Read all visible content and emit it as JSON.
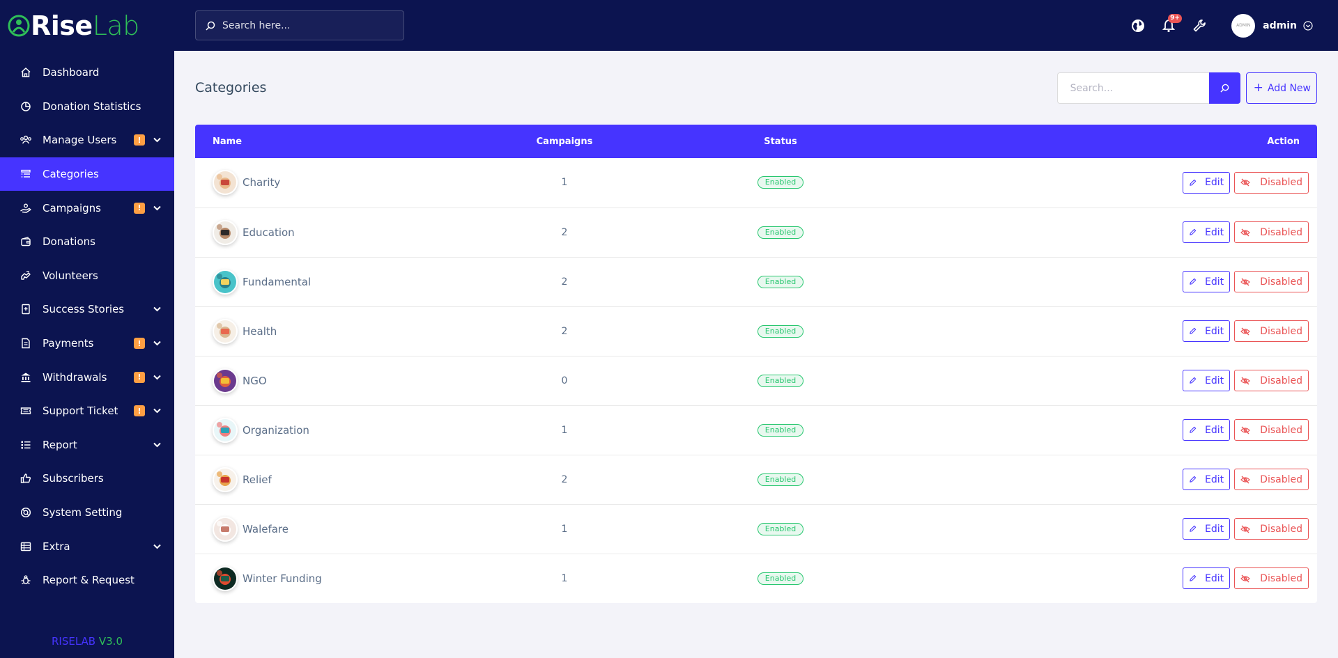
{
  "brand": {
    "name_part1": "Rise",
    "name_part2": "Lab"
  },
  "sidebar": {
    "items": [
      {
        "label": "Dashboard",
        "icon": "home-icon",
        "active": false,
        "warn": false,
        "chevron": false
      },
      {
        "label": "Donation Statistics",
        "icon": "pie-chart-icon",
        "active": false,
        "warn": false,
        "chevron": false
      },
      {
        "label": "Manage Users",
        "icon": "users-icon",
        "active": false,
        "warn": true,
        "chevron": true
      },
      {
        "label": "Categories",
        "icon": "list-icon",
        "active": true,
        "warn": false,
        "chevron": false
      },
      {
        "label": "Campaigns",
        "icon": "hand-holding-icon",
        "active": false,
        "warn": true,
        "chevron": true
      },
      {
        "label": "Donations",
        "icon": "wallet-icon",
        "active": false,
        "warn": false,
        "chevron": false
      },
      {
        "label": "Volunteers",
        "icon": "hands-helping-icon",
        "active": false,
        "warn": false,
        "chevron": false
      },
      {
        "label": "Success Stories",
        "icon": "book-icon",
        "active": false,
        "warn": false,
        "chevron": true
      },
      {
        "label": "Payments",
        "icon": "invoice-icon",
        "active": false,
        "warn": true,
        "chevron": true
      },
      {
        "label": "Withdrawals",
        "icon": "bank-icon",
        "active": false,
        "warn": true,
        "chevron": true
      },
      {
        "label": "Support Ticket",
        "icon": "ticket-icon",
        "active": false,
        "warn": true,
        "chevron": true
      },
      {
        "label": "Report",
        "icon": "list-ul-icon",
        "active": false,
        "warn": false,
        "chevron": true
      },
      {
        "label": "Subscribers",
        "icon": "thumbs-up-icon",
        "active": false,
        "warn": false,
        "chevron": false
      },
      {
        "label": "System Setting",
        "icon": "life-ring-icon",
        "active": false,
        "warn": false,
        "chevron": false
      },
      {
        "label": "Extra",
        "icon": "server-icon",
        "active": false,
        "warn": false,
        "chevron": true
      },
      {
        "label": "Report & Request",
        "icon": "bug-icon",
        "active": false,
        "warn": false,
        "chevron": false
      }
    ],
    "warn_symbol": "!",
    "version_name": "RISELAB",
    "version_number": "V3.0"
  },
  "topbar": {
    "search_placeholder": "Search here...",
    "notification_badge": "9+",
    "user_name": "admin",
    "avatar_text": "ADMIN"
  },
  "main": {
    "page_title": "Categories",
    "search_placeholder": "Search...",
    "add_button_label": "Add New",
    "table": {
      "headers": {
        "name": "Name",
        "campaigns": "Campaigns",
        "status": "Status",
        "action": "Action"
      },
      "rows": [
        {
          "name": "Charity",
          "campaigns": "1",
          "status": "Enabled",
          "thumb_colors": [
            "#f3e3d3",
            "#c9483b",
            "#e9b98a"
          ]
        },
        {
          "name": "Education",
          "campaigns": "2",
          "status": "Enabled",
          "thumb_colors": [
            "#f0ece6",
            "#2d2a2a",
            "#b88a6a"
          ]
        },
        {
          "name": "Fundamental",
          "campaigns": "2",
          "status": "Enabled",
          "thumb_colors": [
            "#49c3c9",
            "#f4d35e",
            "#2a7f8a"
          ]
        },
        {
          "name": "Health",
          "campaigns": "2",
          "status": "Enabled",
          "thumb_colors": [
            "#f6efe6",
            "#e9684f",
            "#d9b892"
          ]
        },
        {
          "name": "NGO",
          "campaigns": "0",
          "status": "Enabled",
          "thumb_colors": [
            "#6b3a8e",
            "#f2c037",
            "#e0603c"
          ]
        },
        {
          "name": "Organization",
          "campaigns": "1",
          "status": "Enabled",
          "thumb_colors": [
            "#e8f6f8",
            "#2aa3b8",
            "#f08080"
          ]
        },
        {
          "name": "Relief",
          "campaigns": "2",
          "status": "Enabled",
          "thumb_colors": [
            "#f7f1ea",
            "#c8342d",
            "#e8a24a"
          ]
        },
        {
          "name": "Walefare",
          "campaigns": "1",
          "status": "Enabled",
          "thumb_colors": [
            "#f2e6e1",
            "#c77b6c",
            "#ffffff"
          ]
        },
        {
          "name": "Winter Funding",
          "campaigns": "1",
          "status": "Enabled",
          "thumb_colors": [
            "#0d2a22",
            "#1f5e4a",
            "#e04a2f"
          ]
        }
      ],
      "edit_label": "Edit",
      "disable_label": "Disabled"
    }
  },
  "colors": {
    "sidebar_bg": "#0c1450",
    "primary": "#4634ff",
    "success": "#28c76f",
    "danger": "#ea5455",
    "warning": "#ff9f43",
    "brand_green": "#2fbf58",
    "page_bg": "#f3f3f9"
  }
}
